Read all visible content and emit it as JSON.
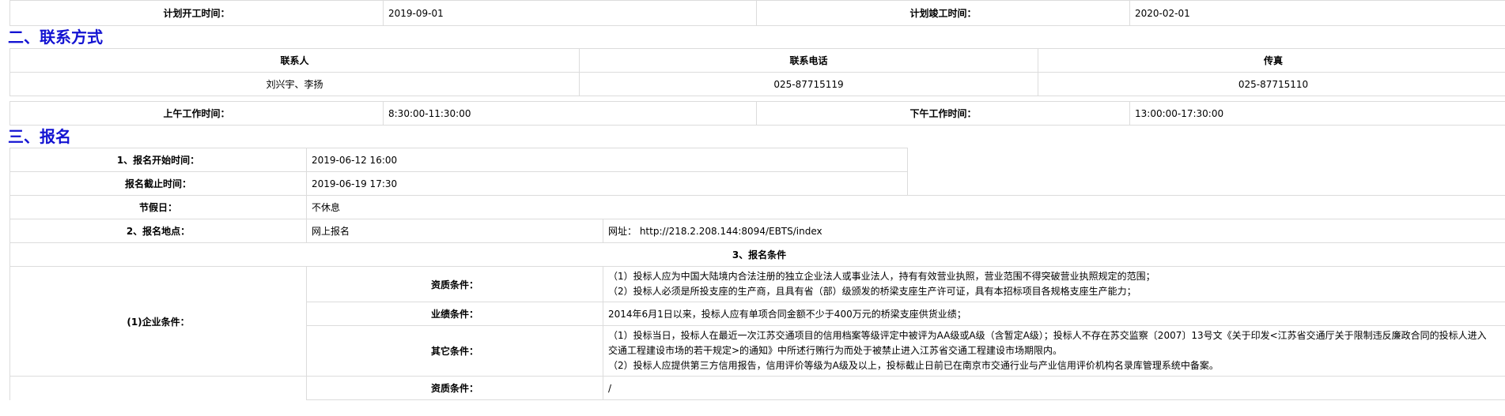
{
  "schedule": {
    "plan_start_label": "计划开工时间：",
    "plan_start_value": "2019-09-01",
    "plan_end_label": "计划竣工时间：",
    "plan_end_value": "2020-02-01"
  },
  "contact": {
    "heading": "二、联系方式",
    "headers": [
      "联系人",
      "联系电话",
      "传真"
    ],
    "values": [
      "刘兴宇、李扬",
      "025-87715119",
      "025-87715110"
    ],
    "am_label": "上午工作时间：",
    "am_value": "8:30:00-11:30:00",
    "pm_label": "下午工作时间：",
    "pm_value": "13:00:00-17:30:00"
  },
  "registration": {
    "heading": "三、报名",
    "start_label": "1、报名开始时间：",
    "start_value": "2019-06-12 16:00",
    "end_label": "报名截止时间：",
    "end_value": "2019-06-19 17:30",
    "holiday_label": "节假日：",
    "holiday_value": "不休息",
    "place_label": "2、报名地点：",
    "place_value": "网上报名",
    "url_text": "网址：  http://218.2.208.144:8094/EBTS/index",
    "conditions_title": "3、报名条件",
    "enterprise_label": "(1)企业条件：",
    "qualification_label": "资质条件：",
    "qualification_lines": [
      "（1）投标人应为中国大陆境内合法注册的独立企业法人或事业法人，持有有效营业执照，营业范围不得突破营业执照规定的范围；",
      "（2）投标人必须是所投支座的生产商，且具有省（部）级颁发的桥梁支座生产许可证，具有本招标项目各规格支座生产能力；"
    ],
    "performance_label": "业绩条件：",
    "performance_value": "2014年6月1日以来，投标人应有单项合同金额不少于400万元的桥梁支座供货业绩；",
    "other_label": "其它条件：",
    "other_lines": [
      "（1）投标当日，投标人在最近一次江苏交通项目的信用档案等级评定中被评为AA级或A级（含暂定A级）；投标人不存在苏交监察〔2007〕13号文《关于印发<江苏省交通厅关于限制违反廉政合同的投标人进入",
      "交通工程建设市场的若干规定>的通知》中所述行贿行为而处于被禁止进入江苏省交通工程建设市场期限内。",
      "（2）投标人应提供第三方信用报告，信用评价等级为A级及以上，投标截止日前已在南京市交通行业与产业信用评价机构名录库管理系统中备案。"
    ],
    "qualification2_label": "资质条件：",
    "qualification2_value": "/"
  }
}
